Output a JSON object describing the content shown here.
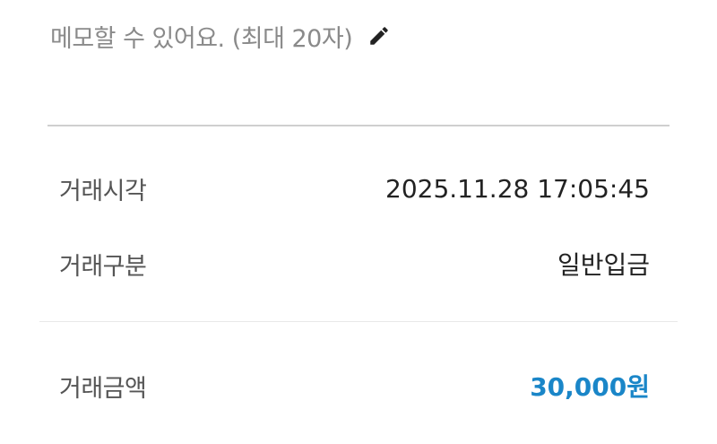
{
  "memo": {
    "placeholder": "메모할 수 있어요. (최대 20자)",
    "edit_icon": "pencil-icon"
  },
  "details": {
    "time_label": "거래시각",
    "time_value": "2025.11.28 17:05:45",
    "type_label": "거래구분",
    "type_value": "일반입금",
    "amount_label": "거래금액",
    "amount_value": "30,000원"
  },
  "colors": {
    "amount": "#1a86c8",
    "placeholder": "#8a8a8a",
    "label": "#555555",
    "value": "#222222"
  }
}
